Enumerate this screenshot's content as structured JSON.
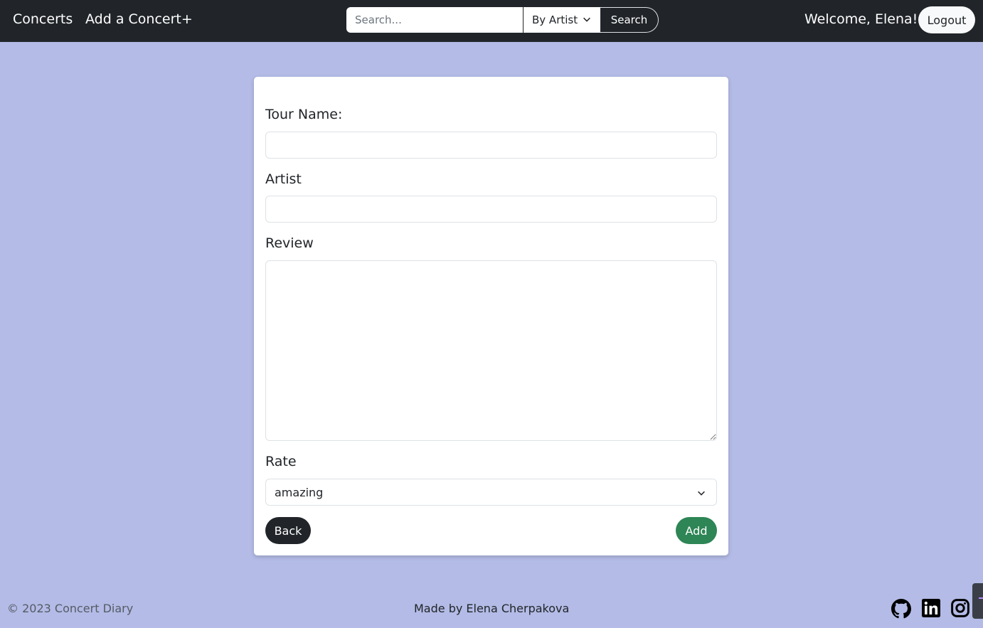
{
  "navbar": {
    "links": [
      {
        "label": "Concerts"
      },
      {
        "label": "Add a Concert+"
      }
    ],
    "search": {
      "placeholder": "Search...",
      "value": "",
      "filter_selected": "By Artist",
      "button_label": "Search"
    },
    "welcome_text": "Welcome, Elena!",
    "logout_label": "Logout"
  },
  "form": {
    "tour_name": {
      "label": "Tour Name:",
      "value": ""
    },
    "artist": {
      "label": "Artist",
      "value": ""
    },
    "review": {
      "label": "Review",
      "value": ""
    },
    "rate": {
      "label": "Rate",
      "selected": "amazing"
    },
    "back_label": "Back",
    "add_label": "Add"
  },
  "footer": {
    "copyright": "© 2023 Concert Diary",
    "made_by": "Made by Elena Cherpakova",
    "social_icons": [
      "github-icon",
      "linkedin-icon",
      "instagram-icon"
    ]
  },
  "colors": {
    "navbar_bg": "#212529",
    "page_bg": "#b3bbe6",
    "add_button": "#2e8555",
    "back_button": "#212529"
  }
}
